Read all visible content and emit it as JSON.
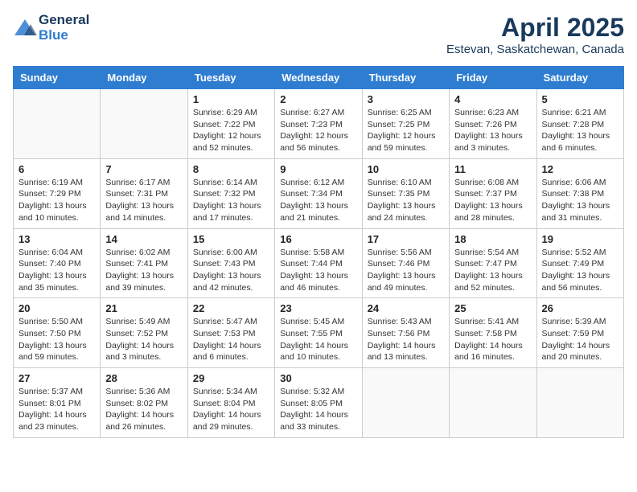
{
  "header": {
    "logo_general": "General",
    "logo_blue": "Blue",
    "month": "April 2025",
    "location": "Estevan, Saskatchewan, Canada"
  },
  "days_of_week": [
    "Sunday",
    "Monday",
    "Tuesday",
    "Wednesday",
    "Thursday",
    "Friday",
    "Saturday"
  ],
  "weeks": [
    [
      {
        "day": "",
        "info": ""
      },
      {
        "day": "",
        "info": ""
      },
      {
        "day": "1",
        "sunrise": "Sunrise: 6:29 AM",
        "sunset": "Sunset: 7:22 PM",
        "daylight": "Daylight: 12 hours and 52 minutes."
      },
      {
        "day": "2",
        "sunrise": "Sunrise: 6:27 AM",
        "sunset": "Sunset: 7:23 PM",
        "daylight": "Daylight: 12 hours and 56 minutes."
      },
      {
        "day": "3",
        "sunrise": "Sunrise: 6:25 AM",
        "sunset": "Sunset: 7:25 PM",
        "daylight": "Daylight: 12 hours and 59 minutes."
      },
      {
        "day": "4",
        "sunrise": "Sunrise: 6:23 AM",
        "sunset": "Sunset: 7:26 PM",
        "daylight": "Daylight: 13 hours and 3 minutes."
      },
      {
        "day": "5",
        "sunrise": "Sunrise: 6:21 AM",
        "sunset": "Sunset: 7:28 PM",
        "daylight": "Daylight: 13 hours and 6 minutes."
      }
    ],
    [
      {
        "day": "6",
        "sunrise": "Sunrise: 6:19 AM",
        "sunset": "Sunset: 7:29 PM",
        "daylight": "Daylight: 13 hours and 10 minutes."
      },
      {
        "day": "7",
        "sunrise": "Sunrise: 6:17 AM",
        "sunset": "Sunset: 7:31 PM",
        "daylight": "Daylight: 13 hours and 14 minutes."
      },
      {
        "day": "8",
        "sunrise": "Sunrise: 6:14 AM",
        "sunset": "Sunset: 7:32 PM",
        "daylight": "Daylight: 13 hours and 17 minutes."
      },
      {
        "day": "9",
        "sunrise": "Sunrise: 6:12 AM",
        "sunset": "Sunset: 7:34 PM",
        "daylight": "Daylight: 13 hours and 21 minutes."
      },
      {
        "day": "10",
        "sunrise": "Sunrise: 6:10 AM",
        "sunset": "Sunset: 7:35 PM",
        "daylight": "Daylight: 13 hours and 24 minutes."
      },
      {
        "day": "11",
        "sunrise": "Sunrise: 6:08 AM",
        "sunset": "Sunset: 7:37 PM",
        "daylight": "Daylight: 13 hours and 28 minutes."
      },
      {
        "day": "12",
        "sunrise": "Sunrise: 6:06 AM",
        "sunset": "Sunset: 7:38 PM",
        "daylight": "Daylight: 13 hours and 31 minutes."
      }
    ],
    [
      {
        "day": "13",
        "sunrise": "Sunrise: 6:04 AM",
        "sunset": "Sunset: 7:40 PM",
        "daylight": "Daylight: 13 hours and 35 minutes."
      },
      {
        "day": "14",
        "sunrise": "Sunrise: 6:02 AM",
        "sunset": "Sunset: 7:41 PM",
        "daylight": "Daylight: 13 hours and 39 minutes."
      },
      {
        "day": "15",
        "sunrise": "Sunrise: 6:00 AM",
        "sunset": "Sunset: 7:43 PM",
        "daylight": "Daylight: 13 hours and 42 minutes."
      },
      {
        "day": "16",
        "sunrise": "Sunrise: 5:58 AM",
        "sunset": "Sunset: 7:44 PM",
        "daylight": "Daylight: 13 hours and 46 minutes."
      },
      {
        "day": "17",
        "sunrise": "Sunrise: 5:56 AM",
        "sunset": "Sunset: 7:46 PM",
        "daylight": "Daylight: 13 hours and 49 minutes."
      },
      {
        "day": "18",
        "sunrise": "Sunrise: 5:54 AM",
        "sunset": "Sunset: 7:47 PM",
        "daylight": "Daylight: 13 hours and 52 minutes."
      },
      {
        "day": "19",
        "sunrise": "Sunrise: 5:52 AM",
        "sunset": "Sunset: 7:49 PM",
        "daylight": "Daylight: 13 hours and 56 minutes."
      }
    ],
    [
      {
        "day": "20",
        "sunrise": "Sunrise: 5:50 AM",
        "sunset": "Sunset: 7:50 PM",
        "daylight": "Daylight: 13 hours and 59 minutes."
      },
      {
        "day": "21",
        "sunrise": "Sunrise: 5:49 AM",
        "sunset": "Sunset: 7:52 PM",
        "daylight": "Daylight: 14 hours and 3 minutes."
      },
      {
        "day": "22",
        "sunrise": "Sunrise: 5:47 AM",
        "sunset": "Sunset: 7:53 PM",
        "daylight": "Daylight: 14 hours and 6 minutes."
      },
      {
        "day": "23",
        "sunrise": "Sunrise: 5:45 AM",
        "sunset": "Sunset: 7:55 PM",
        "daylight": "Daylight: 14 hours and 10 minutes."
      },
      {
        "day": "24",
        "sunrise": "Sunrise: 5:43 AM",
        "sunset": "Sunset: 7:56 PM",
        "daylight": "Daylight: 14 hours and 13 minutes."
      },
      {
        "day": "25",
        "sunrise": "Sunrise: 5:41 AM",
        "sunset": "Sunset: 7:58 PM",
        "daylight": "Daylight: 14 hours and 16 minutes."
      },
      {
        "day": "26",
        "sunrise": "Sunrise: 5:39 AM",
        "sunset": "Sunset: 7:59 PM",
        "daylight": "Daylight: 14 hours and 20 minutes."
      }
    ],
    [
      {
        "day": "27",
        "sunrise": "Sunrise: 5:37 AM",
        "sunset": "Sunset: 8:01 PM",
        "daylight": "Daylight: 14 hours and 23 minutes."
      },
      {
        "day": "28",
        "sunrise": "Sunrise: 5:36 AM",
        "sunset": "Sunset: 8:02 PM",
        "daylight": "Daylight: 14 hours and 26 minutes."
      },
      {
        "day": "29",
        "sunrise": "Sunrise: 5:34 AM",
        "sunset": "Sunset: 8:04 PM",
        "daylight": "Daylight: 14 hours and 29 minutes."
      },
      {
        "day": "30",
        "sunrise": "Sunrise: 5:32 AM",
        "sunset": "Sunset: 8:05 PM",
        "daylight": "Daylight: 14 hours and 33 minutes."
      },
      {
        "day": "",
        "info": ""
      },
      {
        "day": "",
        "info": ""
      },
      {
        "day": "",
        "info": ""
      }
    ]
  ]
}
